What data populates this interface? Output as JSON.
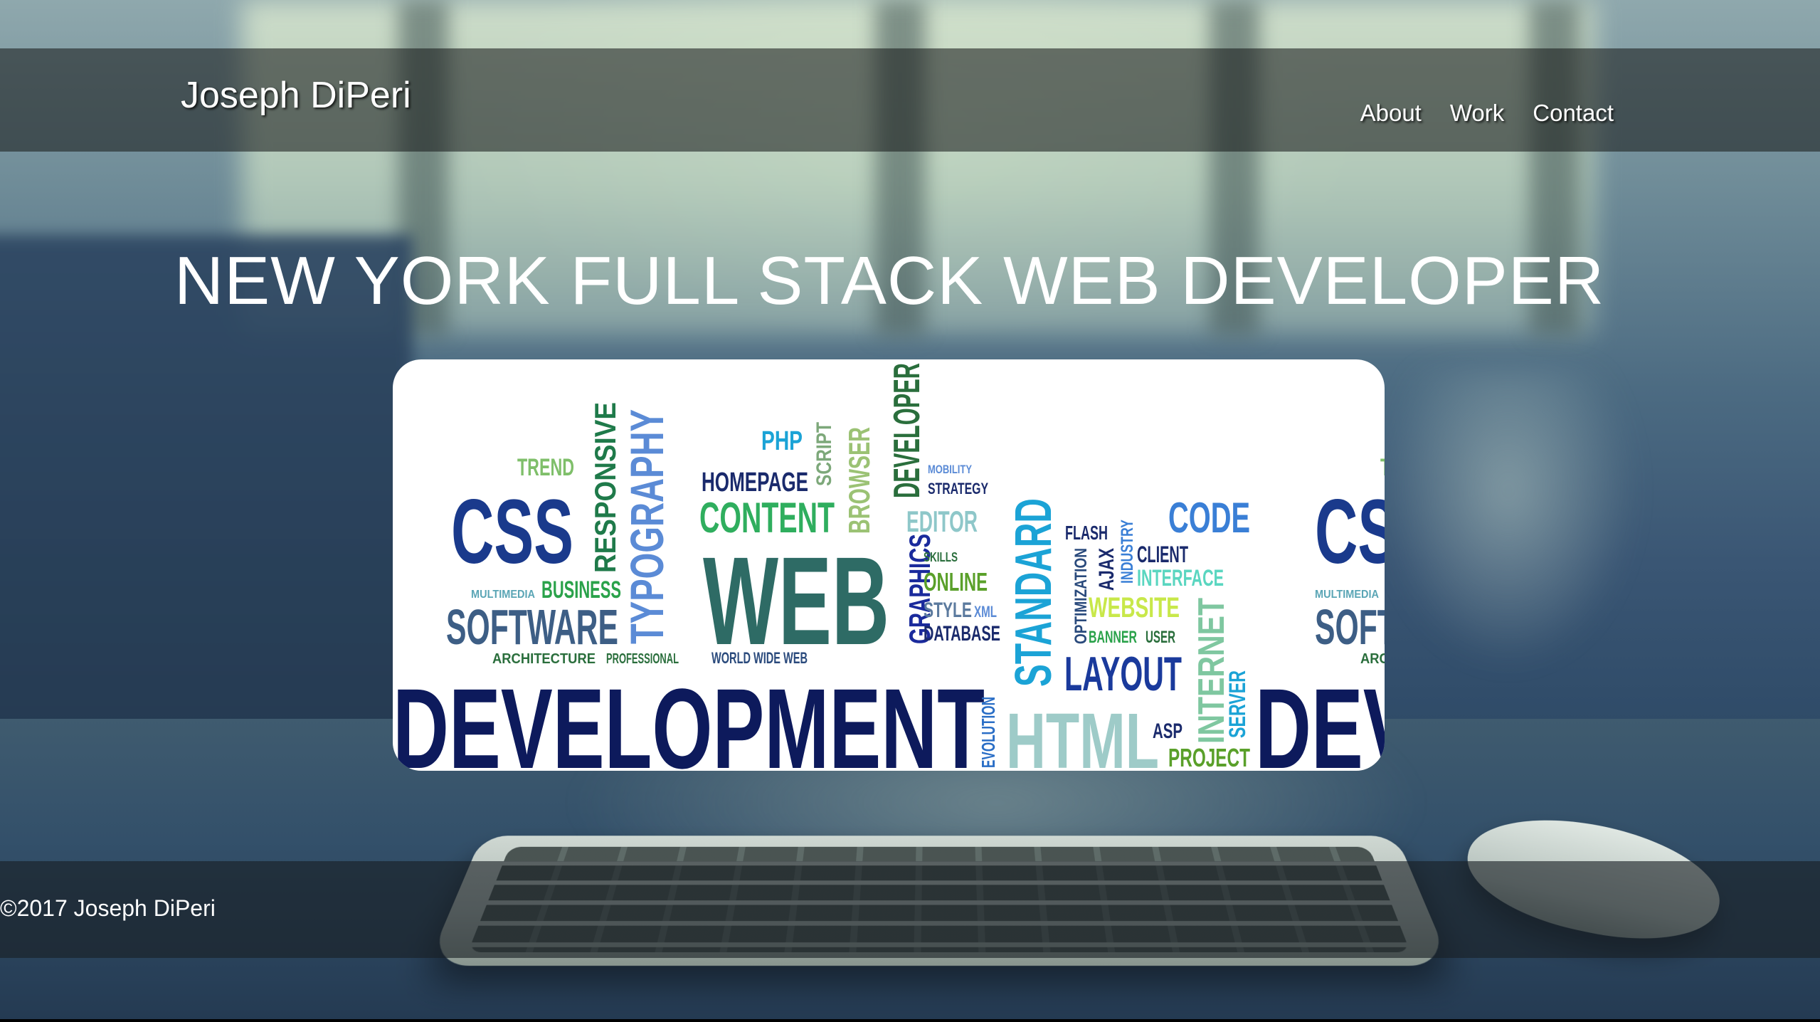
{
  "header": {
    "brand": "Joseph DiPeri",
    "nav": [
      "About",
      "Work",
      "Contact"
    ]
  },
  "hero": {
    "headline": "NEW YORK FULL STACK WEB DEVELOPER"
  },
  "word_cloud": {
    "words": [
      {
        "text": "TREND",
        "color": "#7fbf6a"
      },
      {
        "text": "CSS",
        "color": "#1a3a8c"
      },
      {
        "text": "RESPONSIVE",
        "color": "#1f7a4a"
      },
      {
        "text": "TYPOGRAPHY",
        "color": "#5b8bd6"
      },
      {
        "text": "PHP",
        "color": "#1ba3d6"
      },
      {
        "text": "SCRIPT",
        "color": "#7da87a"
      },
      {
        "text": "HOMEPAGE",
        "color": "#1a2a6c"
      },
      {
        "text": "BROWSER",
        "color": "#9bc274"
      },
      {
        "text": "DEVELOPER",
        "color": "#2a6e3c"
      },
      {
        "text": "MOBILITY",
        "color": "#5b8bd6"
      },
      {
        "text": "STRATEGY",
        "color": "#1a2a6c"
      },
      {
        "text": "CONTENT",
        "color": "#2fae5e"
      },
      {
        "text": "EDITOR",
        "color": "#8ec7c9"
      },
      {
        "text": "MULTIMEDIA",
        "color": "#5aa5b5"
      },
      {
        "text": "BUSINESS",
        "color": "#2aa24a"
      },
      {
        "text": "SOFTWARE",
        "color": "#3d5e85"
      },
      {
        "text": "WEB",
        "color": "#2e6b65"
      },
      {
        "text": "GRAPHICS",
        "color": "#1a2a9c"
      },
      {
        "text": "SKILLS",
        "color": "#2a6e3c"
      },
      {
        "text": "ONLINE",
        "color": "#5aa02a"
      },
      {
        "text": "STYLE",
        "color": "#5b7a9e"
      },
      {
        "text": "XML",
        "color": "#5b8bd6"
      },
      {
        "text": "DATABASE",
        "color": "#1a2a6c"
      },
      {
        "text": "STANDARD",
        "color": "#1ba3d6"
      },
      {
        "text": "FLASH",
        "color": "#1a2a6c"
      },
      {
        "text": "OPTIMIZATION",
        "color": "#2a4a7c"
      },
      {
        "text": "AJAX",
        "color": "#1a2a6c"
      },
      {
        "text": "INDUSTRY",
        "color": "#3a7fd6"
      },
      {
        "text": "CODE",
        "color": "#3a7fd6"
      },
      {
        "text": "CLIENT",
        "color": "#1a2a6c"
      },
      {
        "text": "INTERFACE",
        "color": "#5ad6c0"
      },
      {
        "text": "WEBSITE",
        "color": "#c8e84a"
      },
      {
        "text": "BANNER",
        "color": "#2aa24a"
      },
      {
        "text": "USER",
        "color": "#2a6e3c"
      },
      {
        "text": "LAYOUT",
        "color": "#1a3a9c"
      },
      {
        "text": "INTERNET",
        "color": "#7fc7a0"
      },
      {
        "text": "ARCHITECTURE",
        "color": "#2a6e3c"
      },
      {
        "text": "PROFESSIONAL",
        "color": "#2a6e3c"
      },
      {
        "text": "WORLD WIDE WEB",
        "color": "#2a4a7c"
      },
      {
        "text": "DEVELOPMENT",
        "color": "#0d1a5c"
      },
      {
        "text": "EVOLUTION",
        "color": "#2a6ec6"
      },
      {
        "text": "HTML",
        "color": "#9ecbc8"
      },
      {
        "text": "ASP",
        "color": "#1a2a6c"
      },
      {
        "text": "SERVER",
        "color": "#1ba3d6"
      },
      {
        "text": "PROJECT",
        "color": "#5aa02a"
      }
    ]
  },
  "footer": {
    "copyright": "©2017 Joseph DiPeri"
  }
}
